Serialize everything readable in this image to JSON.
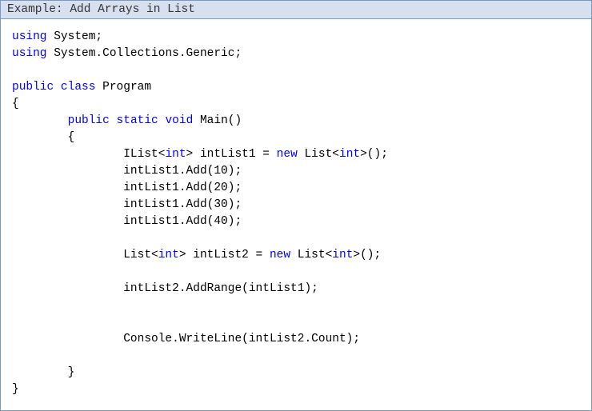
{
  "header": {
    "label": "Example: Add Arrays in List"
  },
  "code": {
    "tokens": [
      {
        "t": "using",
        "c": "kw"
      },
      {
        "t": " System;\n",
        "c": "plain"
      },
      {
        "t": "using",
        "c": "kw"
      },
      {
        "t": " System.Collections.Generic;\n",
        "c": "plain"
      },
      {
        "t": "\n",
        "c": "plain"
      },
      {
        "t": "public",
        "c": "kw"
      },
      {
        "t": " ",
        "c": "plain"
      },
      {
        "t": "class",
        "c": "kw"
      },
      {
        "t": " Program\n",
        "c": "plain"
      },
      {
        "t": "{\n",
        "c": "plain"
      },
      {
        "t": "        ",
        "c": "plain"
      },
      {
        "t": "public",
        "c": "kw"
      },
      {
        "t": " ",
        "c": "plain"
      },
      {
        "t": "static",
        "c": "kw"
      },
      {
        "t": " ",
        "c": "plain"
      },
      {
        "t": "void",
        "c": "kw"
      },
      {
        "t": " Main()\n",
        "c": "plain"
      },
      {
        "t": "        {\n",
        "c": "plain"
      },
      {
        "t": "                IList<",
        "c": "plain"
      },
      {
        "t": "int",
        "c": "kw"
      },
      {
        "t": "> intList1 = ",
        "c": "plain"
      },
      {
        "t": "new",
        "c": "kw"
      },
      {
        "t": " List<",
        "c": "plain"
      },
      {
        "t": "int",
        "c": "kw"
      },
      {
        "t": ">();\n",
        "c": "plain"
      },
      {
        "t": "                intList1.Add(10);\n",
        "c": "plain"
      },
      {
        "t": "                intList1.Add(20);\n",
        "c": "plain"
      },
      {
        "t": "                intList1.Add(30);\n",
        "c": "plain"
      },
      {
        "t": "                intList1.Add(40);\n",
        "c": "plain"
      },
      {
        "t": "\n",
        "c": "plain"
      },
      {
        "t": "                List<",
        "c": "plain"
      },
      {
        "t": "int",
        "c": "kw"
      },
      {
        "t": "> intList2 = ",
        "c": "plain"
      },
      {
        "t": "new",
        "c": "kw"
      },
      {
        "t": " List<",
        "c": "plain"
      },
      {
        "t": "int",
        "c": "kw"
      },
      {
        "t": ">();\n",
        "c": "plain"
      },
      {
        "t": "\n",
        "c": "plain"
      },
      {
        "t": "                intList2.AddRange(intList1);\n",
        "c": "plain"
      },
      {
        "t": "\n",
        "c": "plain"
      },
      {
        "t": "\n",
        "c": "plain"
      },
      {
        "t": "                Console.WriteLine(intList2.Count);\n",
        "c": "plain"
      },
      {
        "t": "\n",
        "c": "plain"
      },
      {
        "t": "        }\n",
        "c": "plain"
      },
      {
        "t": "}",
        "c": "plain"
      }
    ]
  }
}
